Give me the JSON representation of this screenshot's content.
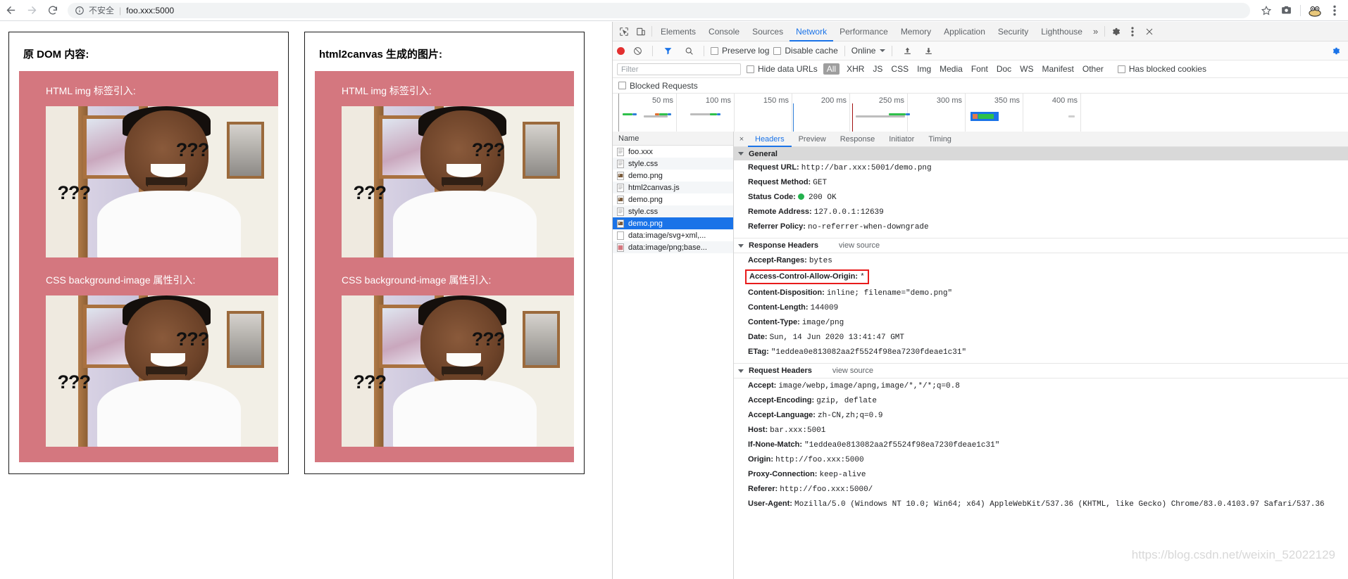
{
  "browser": {
    "back_icon": "back-arrow-icon",
    "forward_icon": "forward-arrow-icon",
    "reload_icon": "reload-icon",
    "security_label": "不安全",
    "url": "foo.xxx:5000",
    "separator": "|",
    "star_icon": "bookmark-star-icon",
    "camera_icon": "screenshot-camera-icon",
    "profile_icon": "profile-avatar-icon",
    "menu_icon": "three-dot-menu-icon"
  },
  "page": {
    "left_panel": {
      "title": "原 DOM 内容:",
      "sections": [
        {
          "label": "HTML img 标签引入:",
          "q_marks": "???"
        },
        {
          "label": "CSS background-image 属性引入:",
          "q_marks": "???"
        }
      ]
    },
    "right_panel": {
      "title": "html2canvas 生成的图片:",
      "sections": [
        {
          "label": "HTML img 标签引入:",
          "q_marks": "???"
        },
        {
          "label": "CSS background-image 属性引入:",
          "q_marks": "???"
        }
      ]
    },
    "card_color": "#d4777f"
  },
  "devtools": {
    "inspect_icon": "inspect-element-icon",
    "device_icon": "device-toolbar-icon",
    "tabs": [
      {
        "label": "Elements",
        "active": false
      },
      {
        "label": "Console",
        "active": false
      },
      {
        "label": "Sources",
        "active": false
      },
      {
        "label": "Network",
        "active": true
      },
      {
        "label": "Performance",
        "active": false
      },
      {
        "label": "Memory",
        "active": false
      },
      {
        "label": "Application",
        "active": false
      },
      {
        "label": "Security",
        "active": false
      },
      {
        "label": "Lighthouse",
        "active": false
      }
    ],
    "more_tabs_icon": "chevron-double-right-icon",
    "settings_icon": "gear-icon",
    "kebab_icon": "three-dot-menu-icon",
    "close_icon": "close-icon",
    "toolbar": {
      "record_icon": "record-button-icon",
      "clear_icon": "clear-requests-icon",
      "filter_icon": "filter-funnel-icon",
      "search_icon": "search-icon",
      "preserve_log": "Preserve log",
      "disable_cache": "Disable cache",
      "throttling": "Online",
      "import_icon": "import-har-icon",
      "export_icon": "export-har-icon"
    },
    "filterbar": {
      "placeholder": "Filter",
      "hide_data_urls": "Hide data URLs",
      "types": [
        "All",
        "XHR",
        "JS",
        "CSS",
        "Img",
        "Media",
        "Font",
        "Doc",
        "WS",
        "Manifest",
        "Other"
      ],
      "selected_type": "All",
      "has_blocked_cookies": "Has blocked cookies",
      "blocked_requests": "Blocked Requests"
    },
    "overview": {
      "ticks": [
        "50 ms",
        "100 ms",
        "150 ms",
        "200 ms",
        "250 ms",
        "300 ms",
        "350 ms",
        "400 ms"
      ]
    },
    "requests": {
      "column_header": "Name",
      "rows": [
        {
          "name": "foo.xxx",
          "type": "doc",
          "selected": false
        },
        {
          "name": "style.css",
          "type": "doc",
          "selected": false
        },
        {
          "name": "demo.png",
          "type": "img",
          "selected": false
        },
        {
          "name": "html2canvas.js",
          "type": "doc",
          "selected": false
        },
        {
          "name": "demo.png",
          "type": "img",
          "selected": false
        },
        {
          "name": "style.css",
          "type": "doc",
          "selected": false
        },
        {
          "name": "demo.png",
          "type": "img",
          "selected": true
        },
        {
          "name": "data:image/svg+xml,...",
          "type": "blank",
          "selected": false
        },
        {
          "name": "data:image/png;base...",
          "type": "img2",
          "selected": false
        }
      ]
    },
    "detail": {
      "close_label": "×",
      "tabs": [
        {
          "label": "Headers",
          "active": true
        },
        {
          "label": "Preview",
          "active": false
        },
        {
          "label": "Response",
          "active": false
        },
        {
          "label": "Initiator",
          "active": false
        },
        {
          "label": "Timing",
          "active": false
        }
      ],
      "general": {
        "title": "General",
        "rows": [
          {
            "key": "Request URL:",
            "value": "http://bar.xxx:5001/demo.png"
          },
          {
            "key": "Request Method:",
            "value": "GET"
          },
          {
            "key": "Status Code:",
            "value": "200 OK",
            "status": true
          },
          {
            "key": "Remote Address:",
            "value": "127.0.0.1:12639"
          },
          {
            "key": "Referrer Policy:",
            "value": "no-referrer-when-downgrade"
          }
        ]
      },
      "response_headers": {
        "title": "Response Headers",
        "view_source": "view source",
        "rows": [
          {
            "key": "Accept-Ranges:",
            "value": "bytes"
          },
          {
            "key": "Access-Control-Allow-Origin:",
            "value": "*",
            "highlighted": true
          },
          {
            "key": "Content-Disposition:",
            "value": "inline; filename=\"demo.png\""
          },
          {
            "key": "Content-Length:",
            "value": "144009"
          },
          {
            "key": "Content-Type:",
            "value": "image/png"
          },
          {
            "key": "Date:",
            "value": "Sun, 14 Jun 2020 13:41:47 GMT"
          },
          {
            "key": "ETag:",
            "value": "\"1eddea0e813082aa2f5524f98ea7230fdeae1c31\""
          }
        ]
      },
      "request_headers": {
        "title": "Request Headers",
        "view_source": "view source",
        "rows": [
          {
            "key": "Accept:",
            "value": "image/webp,image/apng,image/*,*/*;q=0.8"
          },
          {
            "key": "Accept-Encoding:",
            "value": "gzip, deflate"
          },
          {
            "key": "Accept-Language:",
            "value": "zh-CN,zh;q=0.9"
          },
          {
            "key": "Host:",
            "value": "bar.xxx:5001"
          },
          {
            "key": "If-None-Match:",
            "value": "\"1eddea0e813082aa2f5524f98ea7230fdeae1c31\""
          },
          {
            "key": "Origin:",
            "value": "http://foo.xxx:5000"
          },
          {
            "key": "Proxy-Connection:",
            "value": "keep-alive"
          },
          {
            "key": "Referer:",
            "value": "http://foo.xxx:5000/"
          },
          {
            "key": "User-Agent:",
            "value": "Mozilla/5.0 (Windows NT 10.0; Win64; x64) AppleWebKit/537.36 (KHTML, like Gecko) Chrome/83.0.4103.97 Safari/537.36"
          }
        ]
      }
    },
    "highlight_color": "#e81b1b"
  },
  "watermark": "https://blog.csdn.net/weixin_52022129"
}
